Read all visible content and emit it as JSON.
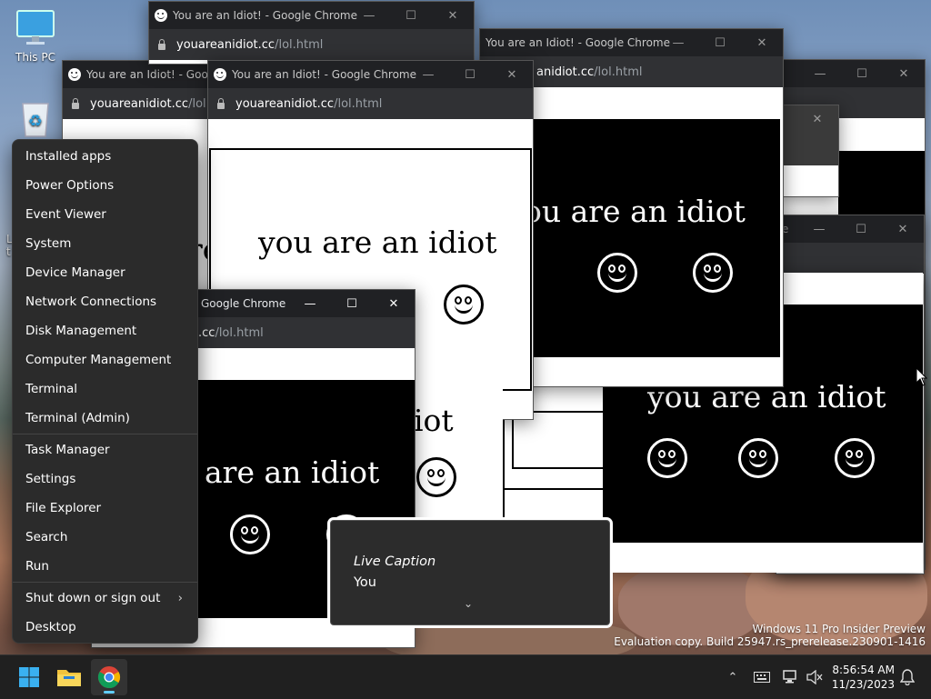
{
  "desktop": {
    "icons": [
      {
        "label": "This PC"
      },
      {
        "label": "R"
      }
    ],
    "side_letters": [
      "L",
      "t"
    ]
  },
  "windows": {
    "title": "You are an Idiot! - Google Chrome",
    "title_partial": "Google Chrome",
    "title_fragment": "e",
    "host": "youareanidiot.cc",
    "path": "/lol.html",
    "host_partial": ".cc",
    "path_partial": "/lol.html",
    "url_fragment": "anidiot.cc",
    "url_fragment_path": "/lol.html",
    "url_fragment2": "youareanidiot.cc",
    "url_fragment2_path": "/lol.",
    "phrase": "you are an idiot",
    "phrase_partial": "are an idiot",
    "phrase_tail": "iot",
    "phrase_tail2": "re",
    "phrase_cut": "ou are an idiot"
  },
  "context_menu": {
    "items": [
      "Installed apps",
      "Power Options",
      "Event Viewer",
      "System",
      "Device Manager",
      "Network Connections",
      "Disk Management",
      "Computer Management",
      "Terminal",
      "Terminal (Admin)"
    ],
    "items2": [
      "Task Manager",
      "Settings",
      "File Explorer",
      "Search",
      "Run"
    ],
    "items3": [
      "Shut down or sign out",
      "Desktop"
    ],
    "submenu_chevron": "›"
  },
  "live_caption": {
    "label": "Live Caption",
    "text": "You",
    "expand_chevron": "⌄"
  },
  "watermark": {
    "line1": "Windows 11 Pro Insider Preview",
    "line2": "Evaluation copy. Build 25947.rs_prerelease.230901-1416"
  },
  "taskbar": {
    "time": "8:56:54 AM",
    "date": "11/23/2023",
    "icons": [
      "windows-start-icon",
      "file-explorer-icon",
      "chrome-icon"
    ],
    "tray_icons": [
      "chevron-up-icon",
      "keyboard-icon",
      "network-icon",
      "volume-muted-icon",
      "notification-bell-icon"
    ]
  },
  "colors": {
    "chrome_dark": "#202124",
    "addr_bar": "#303134",
    "menu_bg": "#2b2b2b",
    "taskbar_bg": "#202020"
  }
}
